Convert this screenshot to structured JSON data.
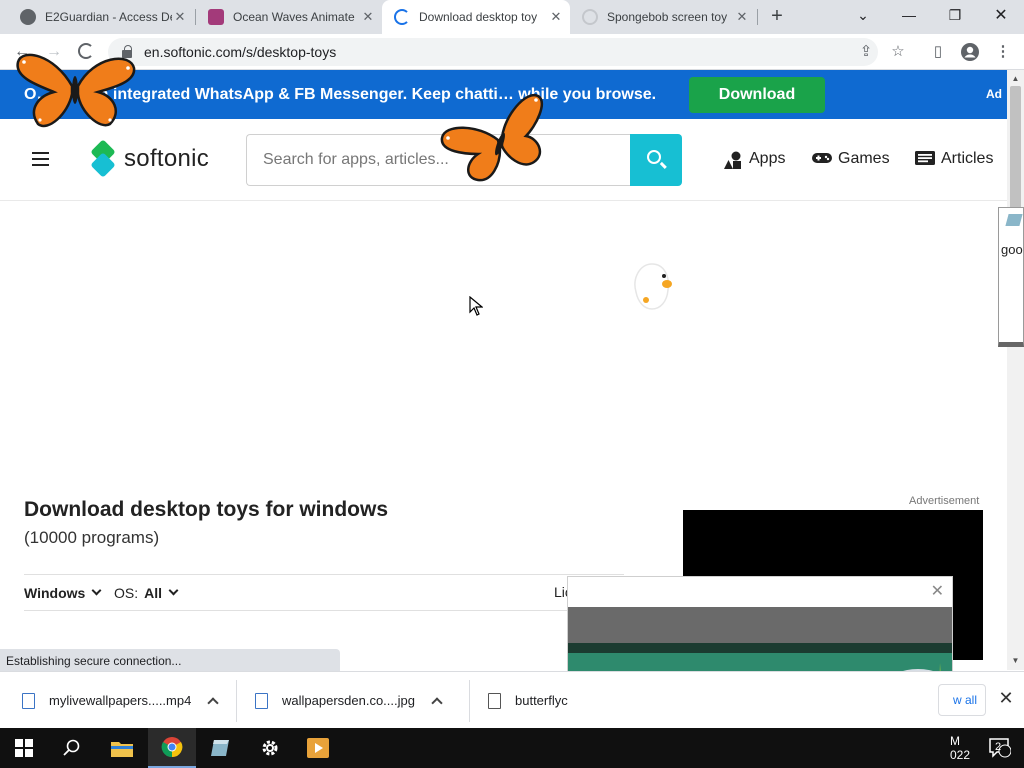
{
  "browser": {
    "tabs": [
      {
        "title": "E2Guardian - Access De",
        "favicon": "globe-icon",
        "active": false
      },
      {
        "title": "Ocean Waves Animate",
        "favicon": "app-icon",
        "active": false
      },
      {
        "title": "Download desktop toy",
        "favicon": "loading-icon",
        "active": true
      },
      {
        "title": "Spongebob screen toy",
        "favicon": "loading-icon",
        "active": false
      }
    ],
    "new_tab": "+",
    "url": "en.softonic.com/s/desktop-toys",
    "status": "Establishing secure connection..."
  },
  "ad_banner": {
    "text": "O… er with integrated WhatsApp & FB Messenger. Keep chatti… while you browse.",
    "button": "Download",
    "tag": "Ad",
    "colors": {
      "background": "#0f6ad1",
      "button": "#1aa34a"
    }
  },
  "site": {
    "logo_text": "softonic",
    "search_placeholder": "Search for apps, articles...",
    "nav": [
      {
        "label": "Apps",
        "icon": "apps-icon"
      },
      {
        "label": "Games",
        "icon": "gamepad-icon"
      },
      {
        "label": "Articles",
        "icon": "newspaper-icon"
      }
    ],
    "accent": "#17bfd3"
  },
  "main": {
    "title": "Download desktop toys for windows",
    "count": "(10000 programs)",
    "filters": {
      "platform": "Windows",
      "os_label": "OS:",
      "os_value": "All",
      "license_partial": "Lic"
    },
    "ad_label": "Advertisement"
  },
  "side_popup": {
    "text": "goo"
  },
  "downloads": {
    "items": [
      {
        "name": "mylivewallpapers.....mp4"
      },
      {
        "name": "wallpapersden.co....jpg"
      },
      {
        "name": "butterflyc"
      }
    ],
    "show_all": "w all"
  },
  "taskbar": {
    "apps": [
      "start-icon",
      "search-icon",
      "file-explorer-icon",
      "chrome-icon",
      "app-icon",
      "settings-icon",
      "media-player-icon"
    ],
    "time": "M",
    "date": "022",
    "notifications": "2"
  }
}
